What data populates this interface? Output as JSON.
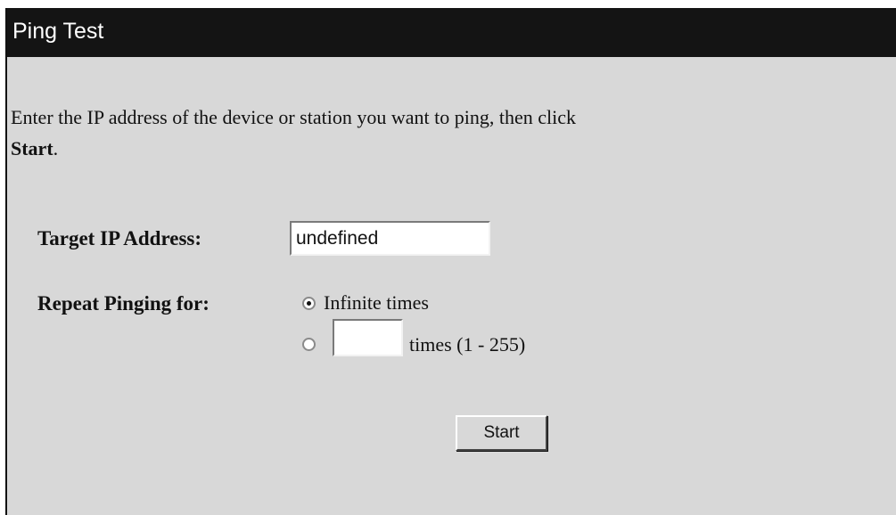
{
  "title": "Ping Test",
  "intro": {
    "text": "Enter the IP address of the device or station you want to ping, then click",
    "bold": "Start",
    "end": "."
  },
  "form": {
    "target_label": "Target IP Address:",
    "target_value": "undefined",
    "repeat_label": "Repeat Pinging for:",
    "option_infinite_label": "Infinite times",
    "option_infinite_selected": true,
    "option_count_selected": false,
    "count_value": "",
    "times_label": "times (1 - 255)"
  },
  "start_button_label": "Start"
}
